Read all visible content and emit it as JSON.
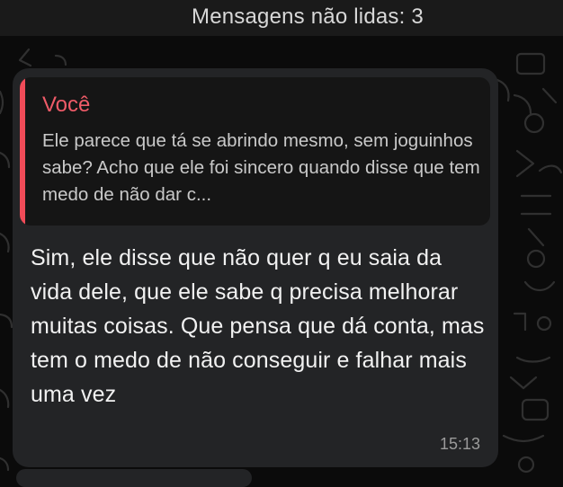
{
  "unread_banner": {
    "text": "Mensagens não lidas: 3"
  },
  "message": {
    "quoted": {
      "author": "Você",
      "text": "Ele parece que tá se abrindo mesmo, sem joguinhos sabe? Acho que ele foi sincero quando disse que tem medo de não dar c..."
    },
    "body": "Sim, ele disse que não quer q eu saia da vida dele, que ele sabe q precisa melhorar muitas coisas. Que pensa que dá conta, mas tem o medo de não conseguir e falhar mais uma vez",
    "time": "15:13"
  },
  "colors": {
    "background": "#0b0b0b",
    "bubble": "#232426",
    "quote_background": "#151515",
    "quote_accent": "#f04b58"
  }
}
